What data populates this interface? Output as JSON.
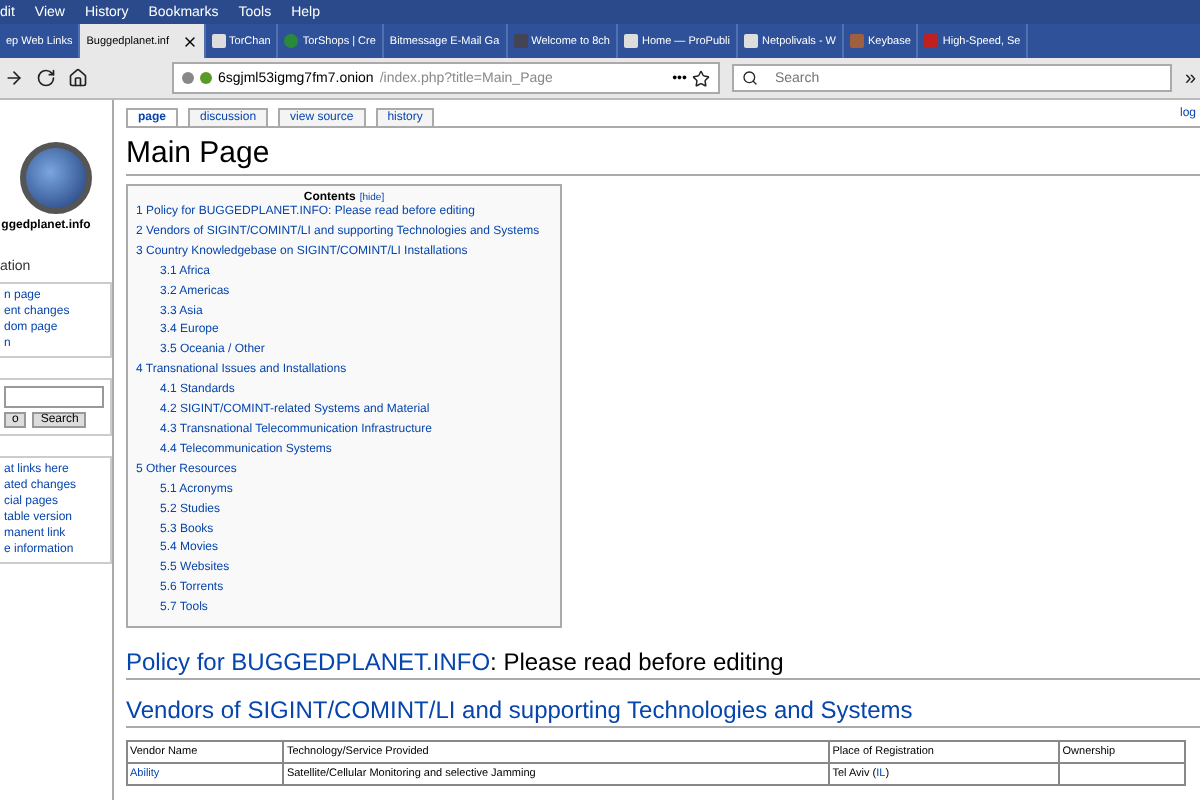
{
  "menu_bar": [
    "dit",
    "View",
    "History",
    "Bookmarks",
    "Tools",
    "Help"
  ],
  "tabs": [
    {
      "label": "ep Web Links",
      "selected": false,
      "kind": "plain"
    },
    {
      "label": "Buggedplanet.inf",
      "selected": true,
      "kind": "plain"
    },
    {
      "label": "TorChan",
      "selected": false,
      "kind": "page"
    },
    {
      "label": "TorShops | Cre",
      "selected": false,
      "kind": "coin"
    },
    {
      "label": "Bitmessage E-Mail Ga",
      "selected": false,
      "kind": "plain"
    },
    {
      "label": "Welcome to 8ch",
      "selected": false,
      "kind": "link"
    },
    {
      "label": "Home — ProPubli",
      "selected": false,
      "kind": "page"
    },
    {
      "label": "Netpolivals - W",
      "selected": false,
      "kind": "page"
    },
    {
      "label": "Keybase",
      "selected": false,
      "kind": "person"
    },
    {
      "label": "High-Speed, Se",
      "selected": false,
      "kind": "check"
    }
  ],
  "address_bar": {
    "host": "6sgjml53igmg7fm7.onion",
    "path": "/index.php?title=Main_Page",
    "menu": "•••"
  },
  "search_bar": {
    "placeholder": "Search"
  },
  "toolbar_overflow": "»",
  "user_link": "log",
  "sidebar": {
    "logo_text": "ggedplanet.info",
    "nav_heading": "ation",
    "nav_items": [
      "n page",
      "ent changes",
      "dom page",
      "n"
    ],
    "search_buttons": [
      "o",
      "Search"
    ],
    "toolbox_items": [
      "at links here",
      "ated changes",
      "cial pages",
      "table version",
      "manent link",
      "e information"
    ]
  },
  "page_tabs": [
    {
      "label": "page",
      "selected": true
    },
    {
      "label": "discussion",
      "selected": false
    },
    {
      "label": "view source",
      "selected": false
    },
    {
      "label": "history",
      "selected": false
    }
  ],
  "title": "Main Page",
  "toc": {
    "title": "Contents",
    "toggle": "[hide]",
    "items": [
      {
        "label": "1 Policy for BUGGEDPLANET.INFO: Please read before editing"
      },
      {
        "label": "2 Vendors of SIGINT/COMINT/LI and supporting Technologies and Systems"
      },
      {
        "label": "3 Country Knowledgebase on SIGINT/COMINT/LI Installations",
        "children": [
          {
            "label": "3.1 Africa"
          },
          {
            "label": "3.2 Americas"
          },
          {
            "label": "3.3 Asia"
          },
          {
            "label": "3.4 Europe"
          },
          {
            "label": "3.5 Oceania / Other"
          }
        ]
      },
      {
        "label": "4 Transnational Issues and Installations",
        "children": [
          {
            "label": "4.1 Standards"
          },
          {
            "label": "4.2 SIGINT/COMINT-related Systems and Material"
          },
          {
            "label": "4.3 Transnational Telecommunication Infrastructure"
          },
          {
            "label": "4.4 Telecommunication Systems"
          }
        ]
      },
      {
        "label": "5 Other Resources",
        "children": [
          {
            "label": "5.1 Acronyms"
          },
          {
            "label": "5.2 Studies"
          },
          {
            "label": "5.3 Books"
          },
          {
            "label": "5.4 Movies"
          },
          {
            "label": "5.5 Websites"
          },
          {
            "label": "5.6 Torrents"
          },
          {
            "label": "5.7 Tools"
          }
        ]
      }
    ]
  },
  "policy_heading": {
    "link": "Policy for BUGGEDPLANET.INFO",
    "rest": ": Please read before editing"
  },
  "vendors_heading": "Vendors of SIGINT/COMINT/LI and supporting Technologies and Systems",
  "table": {
    "columns": [
      "Vendor Name",
      "Technology/Service Provided",
      "Place of Registration",
      "Ownership"
    ],
    "rows": [
      {
        "vendor": "Ability",
        "technology": "Satellite/Cellular Monitoring and selective Jamming",
        "place": "Tel Aviv (",
        "country": "IL",
        "place_end": ")"
      }
    ]
  }
}
